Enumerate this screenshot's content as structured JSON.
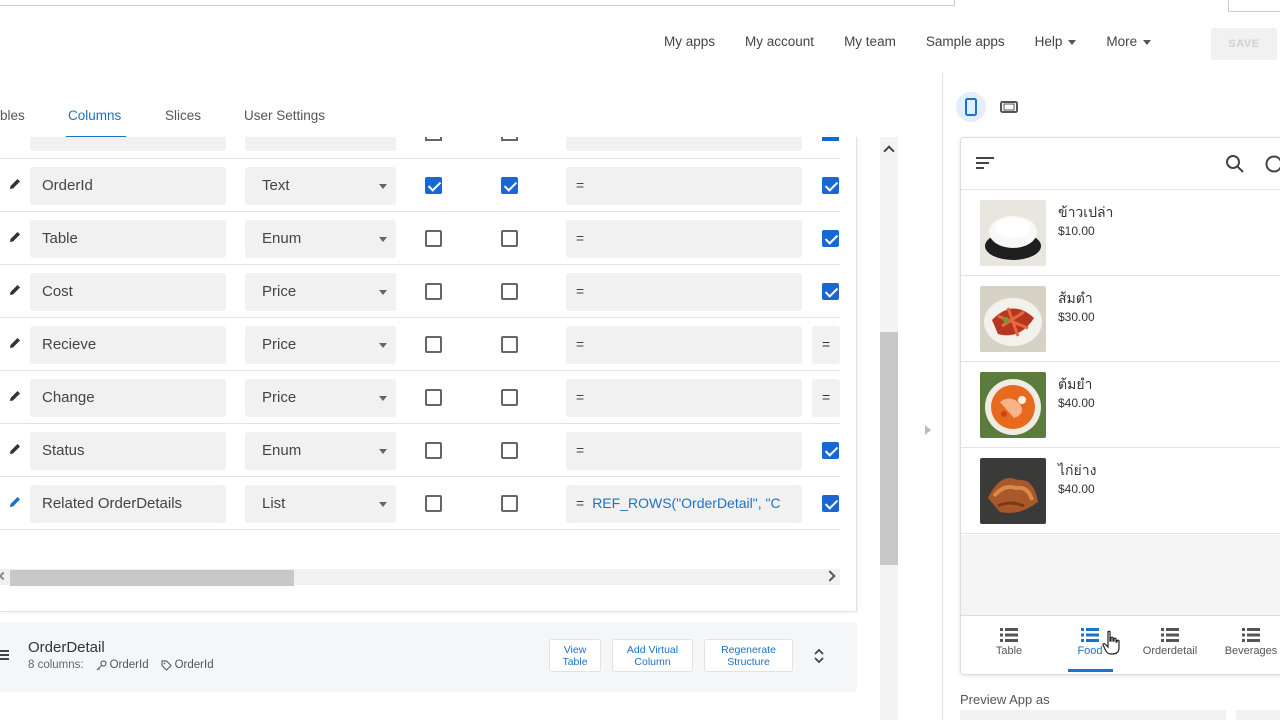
{
  "topnav": {
    "items": [
      "My apps",
      "My account",
      "My team",
      "Sample apps"
    ],
    "dropdowns": [
      "Help",
      "More"
    ],
    "save_label": "SAVE"
  },
  "tabs": [
    "bles",
    "Columns",
    "Slices",
    "User Settings"
  ],
  "active_tab": "Columns",
  "columns": [
    {
      "name": "OrderId",
      "type": "Text",
      "key": true,
      "label": true,
      "formula_eq": "=",
      "formula": "",
      "show": true
    },
    {
      "name": "Table",
      "type": "Enum",
      "key": false,
      "label": false,
      "formula_eq": "=",
      "formula": "",
      "show": true
    },
    {
      "name": "Cost",
      "type": "Price",
      "key": false,
      "label": false,
      "formula_eq": "=",
      "formula": "",
      "show": true
    },
    {
      "name": "Recieve",
      "type": "Price",
      "key": false,
      "label": false,
      "formula_eq": "=",
      "formula": "",
      "show_eq": "="
    },
    {
      "name": "Change",
      "type": "Price",
      "key": false,
      "label": false,
      "formula_eq": "=",
      "formula": "",
      "show_eq": "="
    },
    {
      "name": "Status",
      "type": "Enum",
      "key": false,
      "label": false,
      "formula_eq": "=",
      "formula": "",
      "show": true
    },
    {
      "name": "Related OrderDetails",
      "type": "List",
      "key": false,
      "label": false,
      "formula_eq": "=",
      "formula": "REF_ROWS(\"OrderDetail\", \"C",
      "show": true
    }
  ],
  "table_card": {
    "title": "OrderDetail",
    "columns_count": "8 columns:",
    "key_label": "OrderId",
    "label_label": "OrderId",
    "btn_view": [
      "View",
      "Table"
    ],
    "btn_virtual": [
      "Add Virtual",
      "Column"
    ],
    "btn_regen": [
      "Regenerate",
      "Structure"
    ]
  },
  "preview": {
    "items": [
      {
        "name": "ข้าวเปล่า",
        "price": "$10.00"
      },
      {
        "name": "ส้มตำ",
        "price": "$30.00"
      },
      {
        "name": "ต้มยำ",
        "price": "$40.00"
      },
      {
        "name": "ไก่ย่าง",
        "price": "$40.00"
      }
    ],
    "nav": [
      "Table",
      "Food",
      "Orderdetail",
      "Beverages"
    ],
    "active_nav": "Food",
    "preview_as_label": "Preview App as"
  },
  "colors": {
    "accent": "#1a73c8",
    "checkbox": "#1967d2"
  }
}
